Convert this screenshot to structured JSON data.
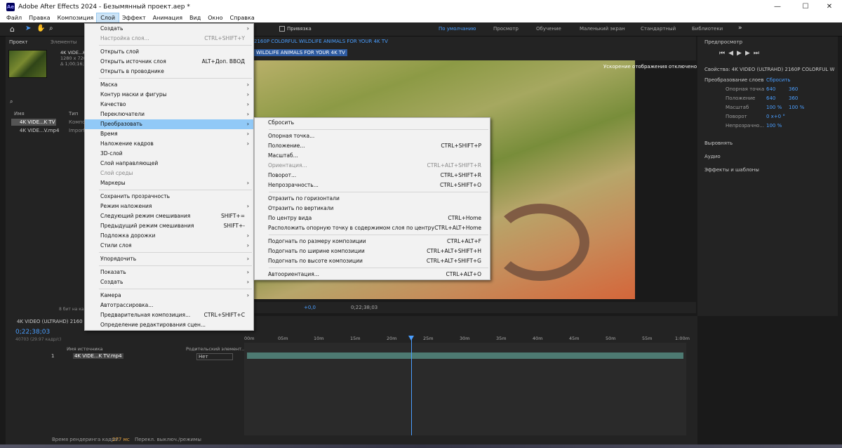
{
  "window": {
    "title": "Adobe After Effects 2024 - Безымянный проект.aep *",
    "logo": "Ae",
    "minimize_icon": "—",
    "maximize_icon": "☐",
    "close_icon": "✕"
  },
  "menubar": [
    "Файл",
    "Правка",
    "Композиция",
    "Слой",
    "Эффект",
    "Анимация",
    "Вид",
    "Окно",
    "Справка"
  ],
  "toolbar": {
    "snap_label": "Привязка",
    "workspaces": [
      "По умолчанию",
      "Просмотр",
      "Обучение",
      "Маленький экран",
      "Стандартный",
      "Библиотеки"
    ],
    "more": "»"
  },
  "project": {
    "tab_project": "Проект",
    "tab_elements": "Элементы",
    "file_name": "4K VIDE...K TV",
    "file_info1": "1280 x 720",
    "file_info2": "Δ 1;00;16;2",
    "col_name": "Имя",
    "col_type": "Тип",
    "items": [
      {
        "name": "4K VIDE...K TV",
        "type": "Компо"
      },
      {
        "name": "4K VIDE...V.mp4",
        "type": "Import"
      }
    ],
    "bit_depth": "8 бит на канал"
  },
  "comp": {
    "tab": "2160P COLORFUL WILDLIFE ANIMALS FOR YOUR 4K TV",
    "subtab": "WILDLIFE ANIMALS FOR YOUR 4K TV",
    "render_note": "Ускорение отображения отключено",
    "exposure": "+0,0",
    "timecode": "0;22;38;03"
  },
  "right": {
    "preview": "Предпросмотр",
    "props_title": "Свойства: 4K VIDEO (ULTRAHD) 2160P COLORFUL W",
    "transform": "Преобразование слоев",
    "reset": "Сбросить",
    "props": [
      {
        "label": "Опорная точка",
        "v1": "640",
        "v2": "360"
      },
      {
        "label": "Положение",
        "v1": "640",
        "v2": "360"
      },
      {
        "label": "Масштаб",
        "v1": "100 %",
        "v2": "100 %"
      },
      {
        "label": "Поворот",
        "v1": "0 x+0 °",
        "v2": ""
      },
      {
        "label": "Непрозрачно...",
        "v1": "100 %",
        "v2": ""
      }
    ],
    "sections": [
      "Выровнять",
      "Аудио",
      "Эффекты и шаблоны"
    ]
  },
  "timeline": {
    "comp_name": "4K VIDEO (ULTRAHD) 2160",
    "timecode": "0;22;38;03",
    "frame_info": "40703 (29.97 кадр/с)",
    "col_source": "Имя источника",
    "col_parent": "Родительский элемент...",
    "layer_num": "1",
    "layer_name": "4K VIDE...K TV.mp4",
    "parent_value": "Нет",
    "ticks": [
      "00m",
      "05m",
      "10m",
      "15m",
      "20m",
      "25m",
      "30m",
      "35m",
      "40m",
      "45m",
      "50m",
      "55m",
      "1:00m"
    ]
  },
  "status": {
    "render_label": "Время рендеринга кадра:",
    "render_value": "277 мс",
    "toggle": "Перекл. выключ./режимы"
  },
  "layer_menu": [
    {
      "label": "Создать",
      "arrow": true
    },
    {
      "label": "Настройка слоя...",
      "shortcut": "CTRL+SHIFT+Y",
      "disabled": true
    },
    {
      "sep": true
    },
    {
      "label": "Открыть слой"
    },
    {
      "label": "Открыть источник слоя",
      "shortcut": "ALT+Доп. ВВОД"
    },
    {
      "label": "Открыть в проводнике"
    },
    {
      "sep": true
    },
    {
      "label": "Маска",
      "arrow": true
    },
    {
      "label": "Контур маски и фигуры",
      "arrow": true
    },
    {
      "label": "Качество",
      "arrow": true
    },
    {
      "label": "Переключатели",
      "arrow": true
    },
    {
      "label": "Преобразовать",
      "arrow": true,
      "highlight": true
    },
    {
      "label": "Время",
      "arrow": true
    },
    {
      "label": "Наложение кадров",
      "arrow": true
    },
    {
      "label": "3D-слой"
    },
    {
      "label": "Слой направляющей"
    },
    {
      "label": "Слой среды",
      "disabled": true
    },
    {
      "label": "Маркеры",
      "arrow": true
    },
    {
      "sep": true
    },
    {
      "label": "Сохранить прозрачность"
    },
    {
      "label": "Режим наложения",
      "arrow": true
    },
    {
      "label": "Следующий режим смешивания",
      "shortcut": "SHIFT+="
    },
    {
      "label": "Предыдущий режим смешивания",
      "shortcut": "SHIFT+-"
    },
    {
      "label": "Подложка дорожки",
      "arrow": true
    },
    {
      "label": "Стили слоя",
      "arrow": true
    },
    {
      "sep": true
    },
    {
      "label": "Упорядочить",
      "arrow": true
    },
    {
      "sep": true
    },
    {
      "label": "Показать",
      "arrow": true
    },
    {
      "label": "Создать",
      "arrow": true
    },
    {
      "sep": true
    },
    {
      "label": "Камера",
      "arrow": true
    },
    {
      "label": "Автотрассировка..."
    },
    {
      "label": "Предварительная композиция...",
      "shortcut": "CTRL+SHIFT+C"
    },
    {
      "label": "Определение редактирования сцен..."
    }
  ],
  "transform_menu": [
    {
      "label": "Сбросить"
    },
    {
      "sep": true
    },
    {
      "label": "Опорная точка..."
    },
    {
      "label": "Положение...",
      "shortcut": "CTRL+SHIFT+P"
    },
    {
      "label": "Масштаб..."
    },
    {
      "label": "Ориентация...",
      "shortcut": "CTRL+ALT+SHIFT+R",
      "disabled": true
    },
    {
      "label": "Поворот...",
      "shortcut": "CTRL+SHIFT+R"
    },
    {
      "label": "Непрозрачность...",
      "shortcut": "CTRL+SHIFT+O"
    },
    {
      "sep": true
    },
    {
      "label": "Отразить по горизонтали"
    },
    {
      "label": "Отразить по вертикали"
    },
    {
      "label": "По центру вида",
      "shortcut": "CTRL+Home"
    },
    {
      "label": "Расположить опорную точку в содержимом слоя по центру",
      "shortcut": "CTRL+ALT+Home"
    },
    {
      "sep": true
    },
    {
      "label": "Подогнать по размеру композиции",
      "shortcut": "CTRL+ALT+F"
    },
    {
      "label": "Подогнать по ширине композиции",
      "shortcut": "CTRL+ALT+SHIFT+H"
    },
    {
      "label": "Подогнать по высоте композиции",
      "shortcut": "CTRL+ALT+SHIFT+G"
    },
    {
      "sep": true
    },
    {
      "label": "Автоориентация...",
      "shortcut": "CTRL+ALT+O"
    }
  ]
}
